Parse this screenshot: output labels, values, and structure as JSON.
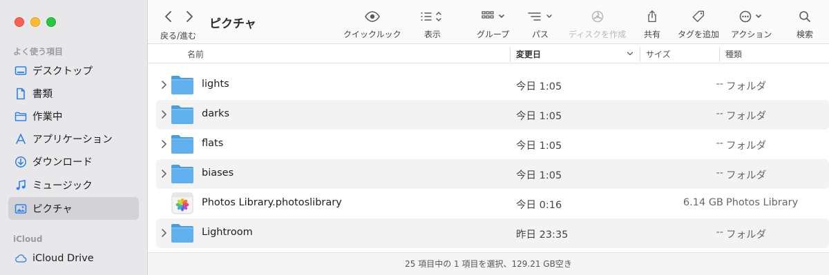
{
  "sidebar": {
    "favorites_header": "よく使う項目",
    "items": [
      {
        "label": "デスクトップ",
        "icon": "desktop-icon"
      },
      {
        "label": "書類",
        "icon": "document-icon"
      },
      {
        "label": "作業中",
        "icon": "folder-icon"
      },
      {
        "label": "アプリケーション",
        "icon": "applications-icon"
      },
      {
        "label": "ダウンロード",
        "icon": "download-icon"
      },
      {
        "label": "ミュージック",
        "icon": "music-icon"
      },
      {
        "label": "ピクチャ",
        "icon": "pictures-icon",
        "active": true
      }
    ],
    "icloud_header": "iCloud",
    "icloud_items": [
      {
        "label": "iCloud Drive",
        "icon": "cloud-icon"
      }
    ]
  },
  "toolbar": {
    "nav_label": "戻る/進む",
    "title": "ピクチャ",
    "quicklook": "クイックルック",
    "view": "表示",
    "group": "グループ",
    "path": "パス",
    "burn": "ディスクを作成",
    "share": "共有",
    "tags": "タグを追加",
    "action": "アクション",
    "search": "検索"
  },
  "columns": {
    "name": "名前",
    "modified": "変更日",
    "size": "サイズ",
    "kind": "種類"
  },
  "files": [
    {
      "name": "lights",
      "date": "今日 1:05",
      "size": "--",
      "kind": "フォルダ",
      "type": "folder"
    },
    {
      "name": "darks",
      "date": "今日 1:05",
      "size": "--",
      "kind": "フォルダ",
      "type": "folder"
    },
    {
      "name": "flats",
      "date": "今日 1:05",
      "size": "--",
      "kind": "フォルダ",
      "type": "folder"
    },
    {
      "name": "biases",
      "date": "今日 1:05",
      "size": "--",
      "kind": "フォルダ",
      "type": "folder"
    },
    {
      "name": "Photos Library.photoslibrary",
      "date": "今日 0:16",
      "size": "6.14 GB",
      "kind": "Photos Library",
      "type": "photos"
    },
    {
      "name": "Lightroom",
      "date": "昨日 23:35",
      "size": "--",
      "kind": "フォルダ",
      "type": "folder"
    }
  ],
  "status": "25 項目中の 1 項目を選択、129.21 GB空き",
  "colors": {
    "accent": "#2a7ff5",
    "sidebar_bg": "#e8e8ea",
    "folder": "#5fb0ec"
  }
}
